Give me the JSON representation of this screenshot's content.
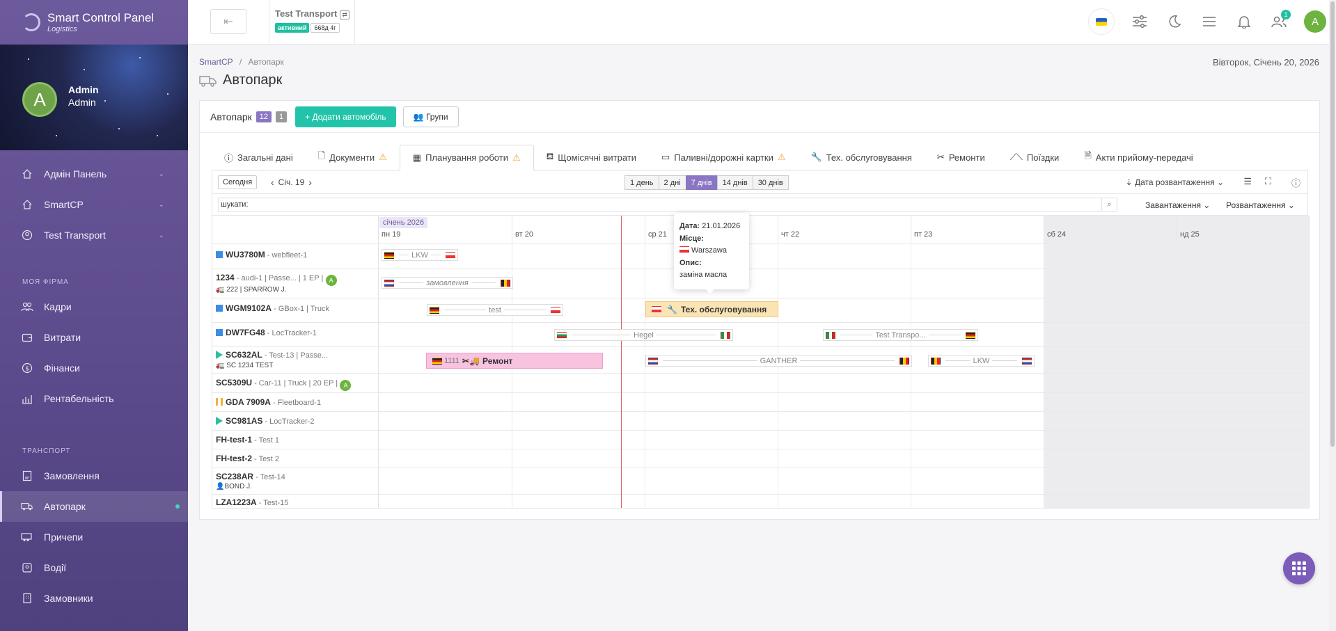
{
  "brand": {
    "title": "Smart Control Panel",
    "subtitle": "Logistics"
  },
  "profile": {
    "initial": "A",
    "name": "Admin",
    "role": "Admin"
  },
  "nav_top": [
    {
      "label": "Адмін Панель",
      "icon": "home-icon",
      "chevron": "⌄"
    },
    {
      "label": "SmartCP",
      "icon": "home-icon",
      "chevron": "⌄"
    },
    {
      "label": "Test Transport",
      "icon": "user-circle-icon",
      "chevron": "⌄"
    }
  ],
  "section_company": "Моя фірма",
  "nav_company": [
    {
      "label": "Кадри",
      "icon": "users-icon"
    },
    {
      "label": "Витрати",
      "icon": "wallet-icon"
    },
    {
      "label": "Фінанси",
      "icon": "dollar-icon"
    },
    {
      "label": "Рентабельність",
      "icon": "chart-icon"
    }
  ],
  "section_transport": "Транспорт",
  "nav_transport": [
    {
      "label": "Замовлення",
      "icon": "order-icon"
    },
    {
      "label": "Автопарк",
      "icon": "truck-icon",
      "active": true
    },
    {
      "label": "Причепи",
      "icon": "trailer-icon"
    },
    {
      "label": "Водії",
      "icon": "driver-icon"
    },
    {
      "label": "Замовники",
      "icon": "building-icon"
    }
  ],
  "topbar": {
    "back_icon": "⇤",
    "company_name": "Test Transport",
    "swap_icon": "⇄",
    "status": "активний",
    "age": "668д 4г",
    "notifications_count": "1",
    "user_initial": "A"
  },
  "breadcrumb": {
    "root": "SmartCP",
    "sep": "/",
    "current": "Автопарк"
  },
  "current_date": "Вівторок, Січень 20, 2026",
  "page_title": "Автопарк",
  "card": {
    "title": "Автопарк",
    "count_active": "12",
    "count_other": "1",
    "add_button": "+ Додати автомобіль",
    "groups_button": "Групи"
  },
  "tabs": [
    {
      "label": "Загальні дані",
      "icon": "ⓘ",
      "warn": false
    },
    {
      "label": "Документи",
      "icon": "🗋",
      "warn": true
    },
    {
      "label": "Планування роботи",
      "icon": "▦",
      "warn": true,
      "active": true
    },
    {
      "label": "Щомісячні витрати",
      "icon": "⛾",
      "warn": false
    },
    {
      "label": "Паливні/дорожні картки",
      "icon": "▭",
      "warn": true
    },
    {
      "label": "Тех. обслуговування",
      "icon": "🔧",
      "warn": false
    },
    {
      "label": "Ремонти",
      "icon": "✂",
      "warn": false
    },
    {
      "label": "Поїздки",
      "icon": "⟋⟍",
      "warn": false
    },
    {
      "label": "Акти прийому-передачі",
      "icon": "🗎",
      "warn": false
    }
  ],
  "toolbar": {
    "today_button": "Сегодня",
    "prev_icon": "‹",
    "next_icon": "›",
    "current_period": "Січ. 19",
    "ranges": [
      "1 день",
      "2 дні",
      "7 днів",
      "14 днів",
      "30 днів"
    ],
    "selected_range": "7 днів",
    "sort_label": "Дата розвантаження"
  },
  "search": {
    "value": "шукати:",
    "loading_filter": "Завантаження",
    "unloading_filter": "Розвантаження"
  },
  "calendar": {
    "month_label": "січень 2026",
    "days": [
      "пн 19",
      "вт 20",
      "ср 21",
      "чт 22",
      "пт 23",
      "сб 24",
      "нд 25"
    ],
    "weekend_days": [
      "сб 24",
      "нд 25"
    ]
  },
  "vehicles": [
    {
      "plate": "WU3780M",
      "desc": " - webfleet-1",
      "marker": "#3b8ee6",
      "marker_shape": "square"
    },
    {
      "plate": "1234",
      "desc": " - audi-1 | Passe... | 1 EP |",
      "line2": "222 | SPARROW J.",
      "badge": "A"
    },
    {
      "plate": "WGM9102A",
      "desc": " - GBox-1 | Truck",
      "marker": "#3b8ee6",
      "marker_shape": "square"
    },
    {
      "plate": "DW7FG48",
      "desc": " - LocTracker-1",
      "marker": "#3b8ee6",
      "marker_shape": "square"
    },
    {
      "plate": "SC632AL",
      "desc": " - Test-13 | Passe...",
      "line2": "SC 1234 TEST",
      "marker": "#2bbfa1",
      "marker_shape": "play"
    },
    {
      "plate": "SC5309U",
      "desc": " - Car-11 | Truck | 20 EP |",
      "badge": "A"
    },
    {
      "plate": "GDA 7909A",
      "desc": " - Fleetboard-1",
      "marker": "#f2b134",
      "marker_shape": "pause"
    },
    {
      "plate": "SC981AS",
      "desc": " - LocTracker-2",
      "marker": "#2bbfa1",
      "marker_shape": "play"
    },
    {
      "plate": "FH-test-1",
      "desc": " - Test 1"
    },
    {
      "plate": "FH-test-2",
      "desc": " - Test 2"
    },
    {
      "plate": "SC238AR",
      "desc": " - Test-14",
      "line2": "BOND J."
    },
    {
      "plate": "LZA1223A",
      "desc": " - Test-15"
    }
  ],
  "events": {
    "trip_lkw_1": "LKW",
    "trip_zam": "замовлення",
    "trip_test": "test",
    "maintenance_label": "Тех. обслуговування",
    "trip_hegel": "Hegel",
    "trip_test_transport": "Test Transpo...",
    "repair_id": "1111",
    "repair_label": "Ремонт",
    "trip_ganther": "GANTHER",
    "trip_lkw_2": "LKW"
  },
  "tooltip": {
    "date_label": "Дата:",
    "date_value": "21.01.2026",
    "place_label": "Місце:",
    "place_value": "Warszawa",
    "desc_label": "Опис:",
    "desc_value": "заміна масла"
  }
}
